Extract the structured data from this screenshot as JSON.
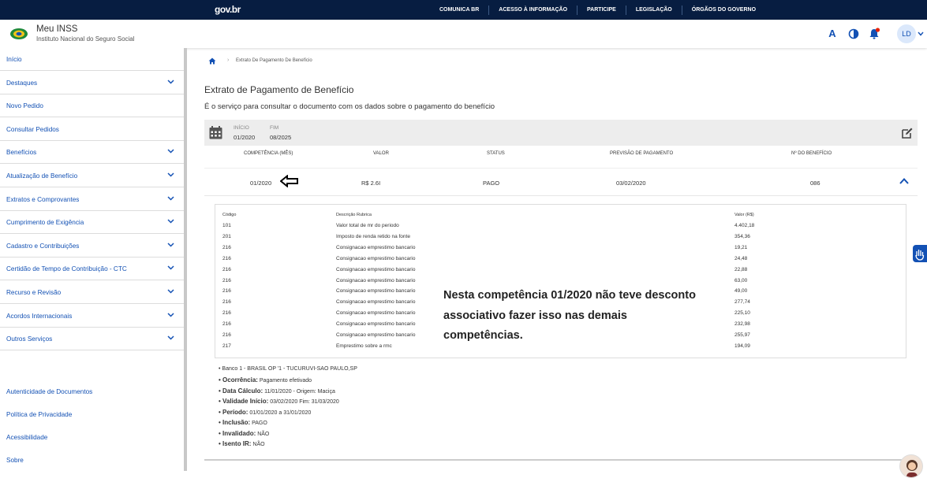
{
  "govbar": {
    "brand": "gov.br",
    "links": [
      "COMUNICA BR",
      "ACESSO À INFORMAÇÃO",
      "PARTICIPE",
      "LEGISLAÇÃO",
      "ÓRGÃOS DO GOVERNO"
    ]
  },
  "header": {
    "title": "Meu INSS",
    "subtitle": "Instituto Nacional do Seguro Social",
    "font_icon_label": "A",
    "avatar_initials": "LD"
  },
  "sidebar": {
    "items": [
      {
        "label": "Início",
        "has_submenu": false
      },
      {
        "label": "Destaques",
        "has_submenu": true
      },
      {
        "label": "Novo Pedido",
        "has_submenu": false
      },
      {
        "label": "Consultar Pedidos",
        "has_submenu": false
      },
      {
        "label": "Benefícios",
        "has_submenu": true
      },
      {
        "label": "Atualização de Benefício",
        "has_submenu": true
      },
      {
        "label": "Extratos e Comprovantes",
        "has_submenu": true
      },
      {
        "label": "Cumprimento de Exigência",
        "has_submenu": true
      },
      {
        "label": "Cadastro e Contribuições",
        "has_submenu": true
      },
      {
        "label": "Certidão de Tempo de Contribuição - CTC",
        "has_submenu": true
      },
      {
        "label": "Recurso e Revisão",
        "has_submenu": true
      },
      {
        "label": "Acordos Internacionais",
        "has_submenu": true
      },
      {
        "label": "Outros Serviços",
        "has_submenu": true
      }
    ],
    "footer": [
      "Autenticidade de Documentos",
      "Política de Privacidade",
      "Acessibilidade",
      "Sobre"
    ]
  },
  "breadcrumb": {
    "current": "Extrato De Pagamento De Benefício"
  },
  "page": {
    "title": "Extrato de Pagamento de Benefício",
    "description": "É o serviço para consultar o documento com os dados sobre o pagamento do benefício"
  },
  "period": {
    "start_label": "INÍCIO",
    "start_value": "01/2020",
    "end_label": "FIM",
    "end_value": "08/2025"
  },
  "table": {
    "headers": [
      "COMPETÊNCIA (MÊS)",
      "VALOR",
      "STATUS",
      "PREVISÃO DE PAGAMENTO",
      "Nº DO BENEFÍCIO"
    ],
    "row": {
      "competencia": "01/2020",
      "valor": "R$ 2.6I",
      "status": "PAGO",
      "previsao": "03/02/2020",
      "beneficio": "086"
    }
  },
  "detail": {
    "headers": [
      "Código",
      "Descrição Rubrica",
      "Valor (R$)"
    ],
    "rows": [
      {
        "code": "101",
        "desc": "Valor total de mr do periodo",
        "value": "4.402,18"
      },
      {
        "code": "201",
        "desc": "Imposto de renda retido na fonte",
        "value": "354,36"
      },
      {
        "code": "216",
        "desc": "Consignacao emprestimo bancario",
        "value": "19,21"
      },
      {
        "code": "216",
        "desc": "Consignacao emprestimo bancario",
        "value": "24,48"
      },
      {
        "code": "216",
        "desc": "Consignacao emprestimo bancario",
        "value": "22,88"
      },
      {
        "code": "216",
        "desc": "Consignacao emprestimo bancario",
        "value": "63,00"
      },
      {
        "code": "216",
        "desc": "Consignacao emprestimo bancario",
        "value": "49,00"
      },
      {
        "code": "216",
        "desc": "Consignacao emprestimo bancario",
        "value": "277,74"
      },
      {
        "code": "216",
        "desc": "Consignacao emprestimo bancario",
        "value": "225,10"
      },
      {
        "code": "216",
        "desc": "Consignacao emprestimo bancario",
        "value": "232,98"
      },
      {
        "code": "216",
        "desc": "Consignacao emprestimo bancario",
        "value": "255,97"
      },
      {
        "code": "217",
        "desc": "Emprestimo sobre a rmc",
        "value": "194,09"
      }
    ]
  },
  "annotation": "Nesta competência 01/2020 não teve desconto associativo fazer isso nas demais competências.",
  "info": {
    "bank": "• Banco 1 - BRASIL OP          '1 - TUCURUVI-SAO PAULO,SP",
    "lines": [
      {
        "label": "• Ocorrência:",
        "value": " Pagamento efetivado"
      },
      {
        "label": "• Data Cálculo:",
        "value": " 11/01/2020 - Origem: Maciça"
      },
      {
        "label": "• Validade Início:",
        "value": " 03/02/2020 Fim: 31/03/2020"
      },
      {
        "label": "• Período:",
        "value": " 01/01/2020 a 31/01/2020"
      },
      {
        "label": "• Inclusão:",
        "value": " PAGO"
      },
      {
        "label": "• Invalidado:",
        "value": " NÃO"
      },
      {
        "label": "• Isento IR:",
        "value": " NÃO"
      }
    ]
  },
  "colors": {
    "govbar": "#071d41",
    "link": "#1351b4",
    "accent_red": "#e52207"
  }
}
